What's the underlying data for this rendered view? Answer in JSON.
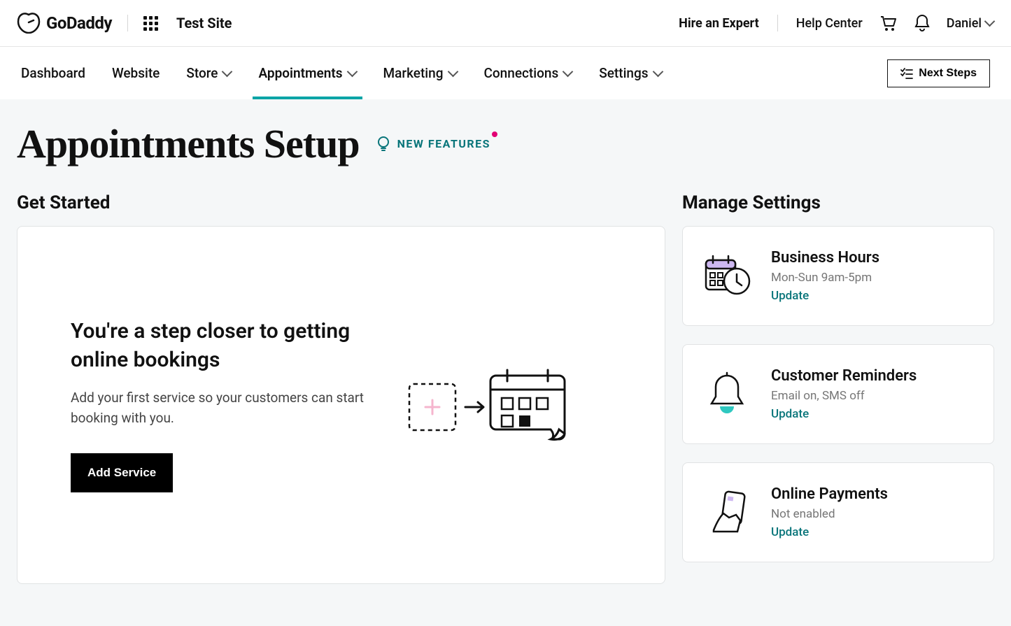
{
  "header": {
    "brand": "GoDaddy",
    "site_name": "Test Site",
    "hire_expert": "Hire an Expert",
    "help_center": "Help Center",
    "user_name": "Daniel"
  },
  "nav": {
    "items": [
      {
        "label": "Dashboard",
        "dropdown": false
      },
      {
        "label": "Website",
        "dropdown": false
      },
      {
        "label": "Store",
        "dropdown": true
      },
      {
        "label": "Appointments",
        "dropdown": true,
        "active": true
      },
      {
        "label": "Marketing",
        "dropdown": true
      },
      {
        "label": "Connections",
        "dropdown": true
      },
      {
        "label": "Settings",
        "dropdown": true
      }
    ],
    "next_steps": "Next Steps"
  },
  "page": {
    "title": "Appointments Setup",
    "new_features": "NEW FEATURES"
  },
  "get_started": {
    "section_title": "Get Started",
    "heading": "You're a step closer to getting online bookings",
    "description": "Add your first service so your customers can start booking with you.",
    "button": "Add Service"
  },
  "manage_settings": {
    "section_title": "Manage Settings",
    "cards": [
      {
        "title": "Business Hours",
        "status": "Mon-Sun 9am-5pm",
        "action": "Update"
      },
      {
        "title": "Customer Reminders",
        "status": "Email on, SMS off",
        "action": "Update"
      },
      {
        "title": "Online Payments",
        "status": "Not enabled",
        "action": "Update"
      }
    ]
  }
}
